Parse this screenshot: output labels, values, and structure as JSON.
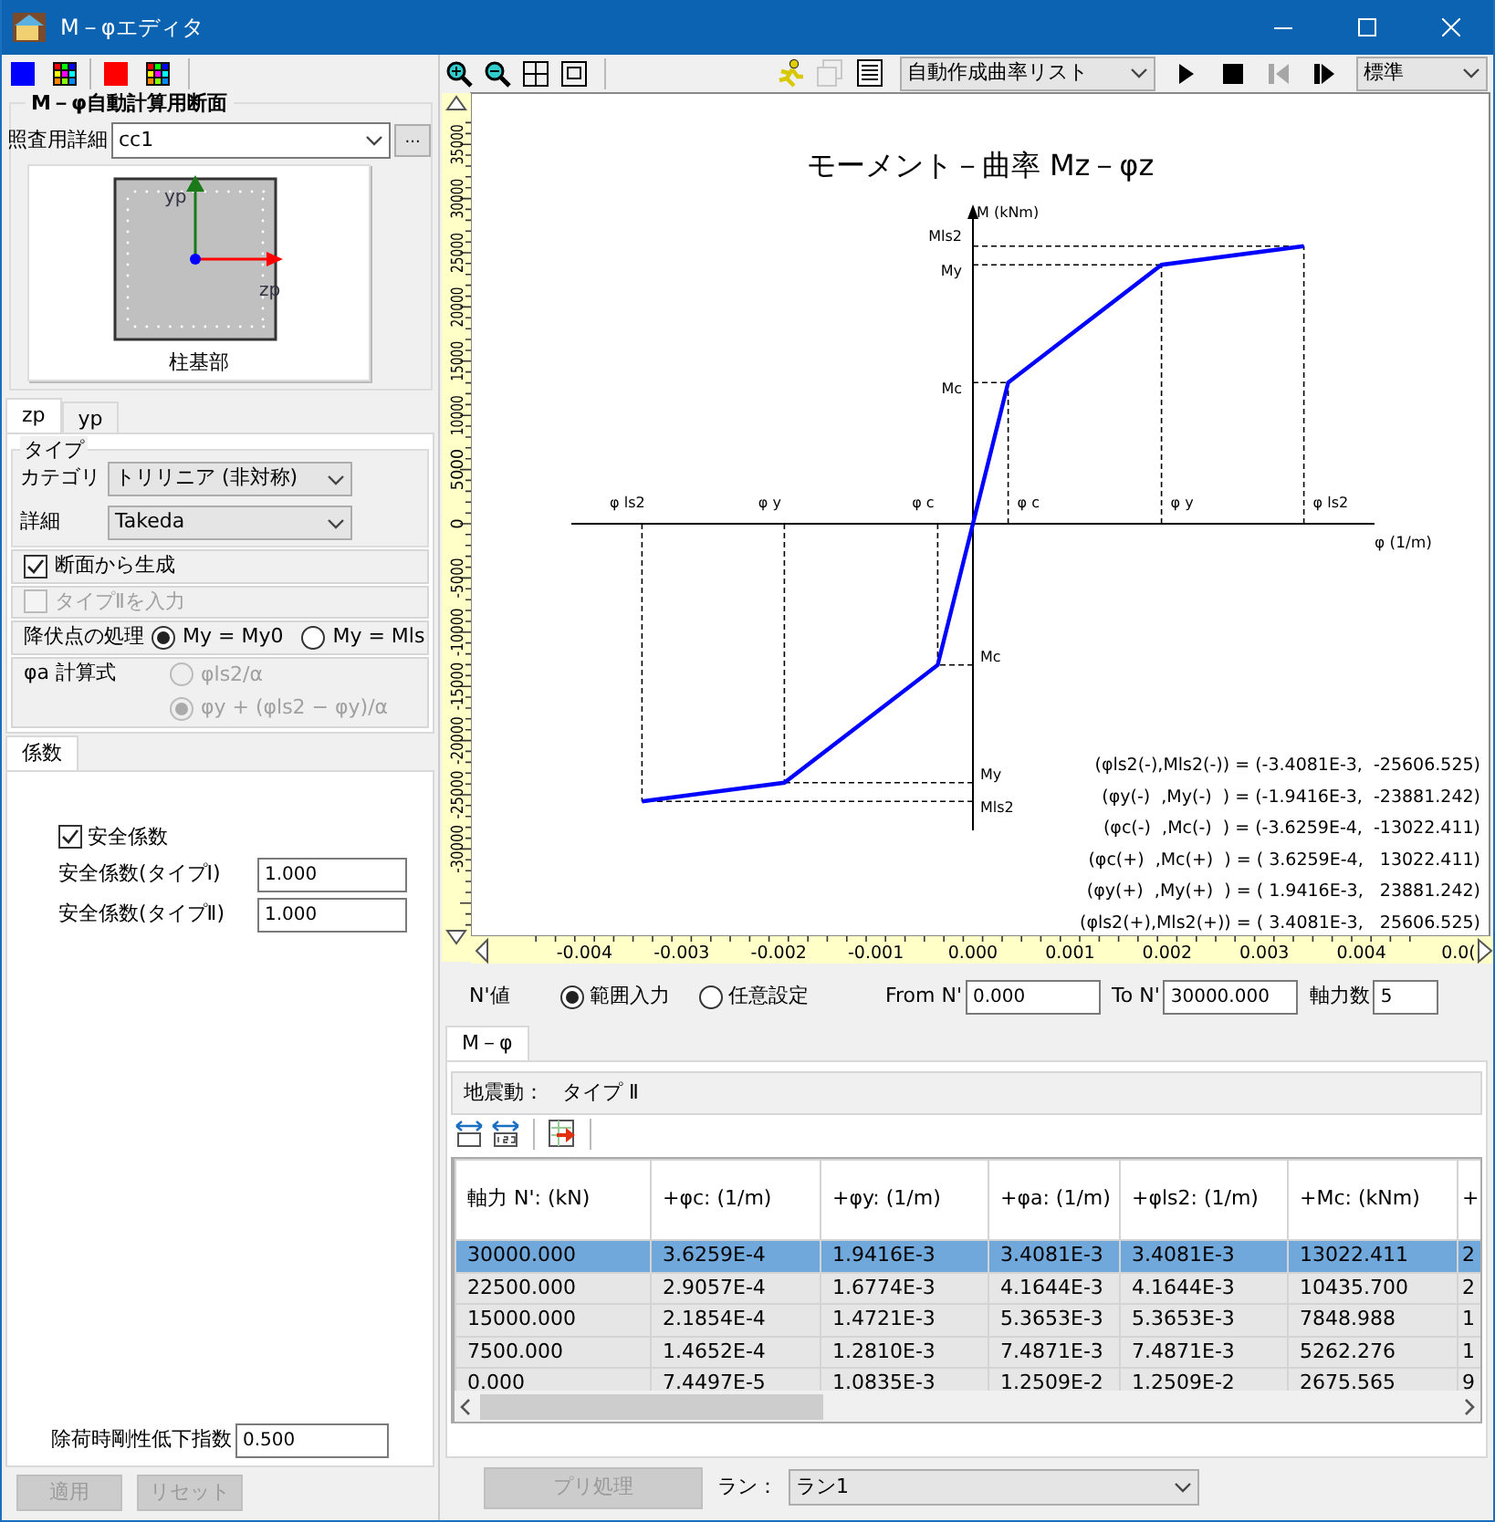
{
  "window": {
    "title": "M－φエディタ"
  },
  "left_toolbar": [
    {
      "kind": "swatch",
      "color": "#0000ff"
    },
    {
      "kind": "palette"
    },
    {
      "kind": "swatch",
      "color": "#ff0000"
    },
    {
      "kind": "palette"
    }
  ],
  "section": {
    "title": "M－φ自動計算用断面",
    "detail_label": "照査用詳細",
    "detail_value": "cc1",
    "browse_button": "...",
    "axis_labels": [
      "yp",
      "zp"
    ],
    "caption": "柱基部"
  },
  "axis_tabs": [
    {
      "label": "zp",
      "selected": true
    },
    {
      "label": "yp",
      "selected": false
    }
  ],
  "type_group": {
    "title": "タイプ",
    "fields": [
      {
        "label": "カテゴリ",
        "value": "トリリニア (非対称)"
      },
      {
        "label": "詳細",
        "value": "Takeda"
      }
    ]
  },
  "options": [
    {
      "kind": "checkbox",
      "label": "断面から生成",
      "checked": true,
      "disabled": false
    },
    {
      "kind": "checkbox",
      "label": "タイプⅡを入力",
      "checked": false,
      "disabled": true
    },
    {
      "kind": "radio-row",
      "label": "降伏点の処理",
      "disabled": false,
      "choices": [
        {
          "label": "My = My0",
          "selected": true
        },
        {
          "label": "My = Mls",
          "selected": false
        }
      ]
    },
    {
      "kind": "radio-stack",
      "label": "φa 計算式",
      "disabled": true,
      "choices": [
        {
          "label": "φls2/α",
          "selected": false
        },
        {
          "label": "φy + (φls2 − φy)/α",
          "selected": true
        }
      ]
    }
  ],
  "coef_tabs": [
    {
      "label": "係数",
      "selected": true
    }
  ],
  "coefficients": {
    "safety": {
      "label": "安全係数",
      "checked": true
    },
    "fields": [
      {
        "label": "安全係数(タイプⅠ)",
        "value": "1.000"
      },
      {
        "label": "安全係数(タイプⅡ)",
        "value": "1.000"
      }
    ],
    "unload": {
      "label": "除荷時剛性低下指数",
      "value": "0.500"
    }
  },
  "left_buttons": [
    {
      "label": "適用",
      "disabled": true
    },
    {
      "label": "リセット",
      "disabled": true
    }
  ],
  "chart_toolbar": {
    "view_tools": [
      {
        "kind": "zoom-in"
      },
      {
        "kind": "zoom-out"
      },
      {
        "kind": "fit"
      },
      {
        "kind": "frame"
      }
    ],
    "run_tools": [
      {
        "kind": "runner",
        "disabled": false
      },
      {
        "kind": "copy",
        "disabled": true
      },
      {
        "kind": "list",
        "disabled": false
      }
    ],
    "list_select": "自動作成曲率リスト",
    "player": [
      {
        "kind": "play",
        "disabled": false
      },
      {
        "kind": "stop",
        "disabled": false
      },
      {
        "kind": "step-back",
        "disabled": true
      },
      {
        "kind": "step-forward",
        "disabled": false
      }
    ],
    "view_select": "標準"
  },
  "chart": {
    "chart_data": {
      "type": "line",
      "title": "モーメント－曲率 Mz－φz",
      "xlabel": "φ (1/m)",
      "ylabel": "M (kNm)",
      "x": [
        -0.0034081,
        -0.0019416,
        -0.00036259,
        0,
        0.00036259,
        0.0019416,
        0.0034081
      ],
      "series": [
        {
          "color": "#0000ff",
          "values": [
            -25606.525,
            -23881.242,
            -13022.411,
            0,
            13022.411,
            23881.242,
            25606.525
          ]
        }
      ],
      "xlim": [
        -0.00517,
        0.00532
      ],
      "ylim": [
        -38047,
        39731
      ],
      "xticks": [
        -0.004,
        -0.003,
        -0.002,
        -0.001,
        {
          "value": 0,
          "label": "0.000"
        },
        0.001,
        0.002,
        0.003,
        0.004,
        {
          "value": 0.005,
          "label": "0.0("
        }
      ],
      "yticks": [
        -30000,
        -25000,
        -20000,
        -15000,
        -10000,
        -5000,
        0,
        5000,
        10000,
        15000,
        20000,
        25000,
        30000,
        35000
      ],
      "annotations": [
        "φ ls2",
        "φ y",
        "φ c",
        "φ c",
        "φ y",
        "φ ls2",
        "Mls2",
        "My",
        "Mc",
        "Mc",
        "My",
        "Mls2"
      ]
    },
    "point_list": [
      "(φls2(-),Mls2(-)) = (-3.4081E-3,  -25606.525)",
      "(φy(-)  ,My(-)  ) = (-1.9416E-3,  -23881.242)",
      "(φc(-)  ,Mc(-)  ) = (-3.6259E-4,  -13022.411)",
      "(φc(+)  ,Mc(+)  ) = ( 3.6259E-4,   13022.411)",
      "(φy(+)  ,My(+)  ) = ( 1.9416E-3,   23881.242)",
      "(φls2(+),Mls2(+)) = ( 3.4081E-3,   25606.525)"
    ]
  },
  "n_values": {
    "label": "N'値",
    "choices": [
      {
        "label": "範囲入力",
        "selected": true
      },
      {
        "label": "任意設定",
        "selected": false
      }
    ],
    "fields": [
      {
        "label": "From N'",
        "value": "0.000"
      },
      {
        "label": "To N'",
        "value": "30000.000"
      },
      {
        "label": "軸力数",
        "value": "5"
      }
    ]
  },
  "result_tabs": [
    {
      "label": "M－φ",
      "selected": true
    }
  ],
  "ground_motion": {
    "label": "地震動：",
    "value": "タイプ Ⅱ"
  },
  "table_tools": [
    {
      "kind": "fit-width"
    },
    {
      "kind": "fit-number"
    },
    {
      "kind": "export"
    }
  ],
  "table": {
    "columns": [
      "軸力 N': (kN)",
      "+φc: (1/m)",
      "+φy: (1/m)",
      "+φa: (1/m)",
      "+φls2: (1/m)",
      "+Mc: (kNm)",
      "+"
    ],
    "rows": [
      {
        "selected": true,
        "cells": [
          "30000.000",
          "3.6259E-4",
          "1.9416E-3",
          "3.4081E-3",
          "3.4081E-3",
          "13022.411",
          "2"
        ]
      },
      {
        "selected": false,
        "cells": [
          "22500.000",
          "2.9057E-4",
          "1.6774E-3",
          "4.1644E-3",
          "4.1644E-3",
          "10435.700",
          "2"
        ]
      },
      {
        "selected": false,
        "cells": [
          "15000.000",
          "2.1854E-4",
          "1.4721E-3",
          "5.3653E-3",
          "5.3653E-3",
          "7848.988",
          "1"
        ]
      },
      {
        "selected": false,
        "cells": [
          "7500.000",
          "1.4652E-4",
          "1.2810E-3",
          "7.4871E-3",
          "7.4871E-3",
          "5262.276",
          "1"
        ]
      },
      {
        "selected": false,
        "cells": [
          "0.000",
          "7.4497E-5",
          "1.0835E-3",
          "1.2509E-2",
          "1.2509E-2",
          "2675.565",
          "9"
        ]
      }
    ]
  },
  "pre_button": {
    "label": "プリ処理",
    "disabled": true
  },
  "run": {
    "label": "ラン：",
    "value": "ラン1"
  }
}
